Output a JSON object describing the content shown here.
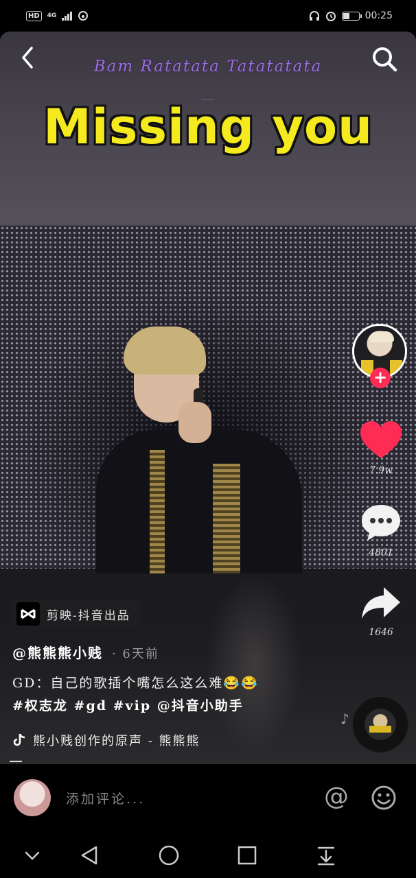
{
  "status_bar": {
    "hd": "HD",
    "network": "4G",
    "time": "00:25"
  },
  "video": {
    "lyric_top": "Bam Ratatata Tatatatata",
    "lyric_dots": "......",
    "lyric_main": "Missing you"
  },
  "actions": {
    "likes": "7.9w",
    "comments": "4801",
    "shares": "1646"
  },
  "caption": {
    "capcut_label": "剪映-抖音出品",
    "author": "@熊熊熊小贱",
    "time_ago": "· 6天前",
    "text": "GD：自己的歌插个嘴怎么这么难😂😂",
    "hashtags": "#权志龙 #gd #vip @抖音小助手",
    "music": "熊小贱创作的原声 - 熊熊熊"
  },
  "comment_bar": {
    "placeholder": "添加评论..."
  },
  "icons": {
    "back": "chevron-left-icon",
    "search": "search-icon",
    "like": "heart-icon",
    "comment": "chat-bubble-icon",
    "share": "share-arrow-icon",
    "mention": "at-icon",
    "emoji": "smiley-icon"
  },
  "colors": {
    "like": "#fe2c55",
    "lyric_main": "#f5ea1d",
    "lyric_top": "#9b6ee0"
  }
}
